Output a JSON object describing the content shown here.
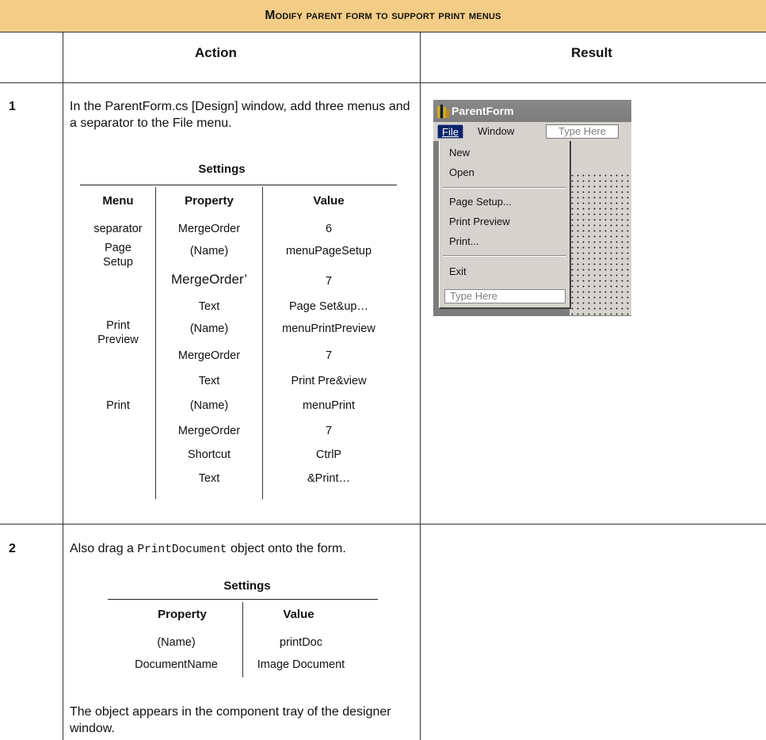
{
  "title": "Modify parent form to support print menus",
  "headers": {
    "action": "Action",
    "result": "Result"
  },
  "step1": {
    "number": "1",
    "text": "In the ParentForm.cs [Design] window, add three menus and a separator to the File menu.",
    "settings_title": "Settings",
    "columns": [
      "Menu",
      "Property",
      "Value"
    ],
    "rows": [
      {
        "menu": "separator",
        "property": "MergeOrder",
        "value": "6"
      },
      {
        "menu": "Page Setup",
        "property": "(Name)",
        "value": "menuPageSetup"
      },
      {
        "menu": "",
        "property": "MergeOrder’",
        "value": "7"
      },
      {
        "menu": "",
        "property": "Text",
        "value": "Page Set&up…"
      },
      {
        "menu": "Print Preview",
        "property": "(Name)",
        "value": "menuPrintPreview"
      },
      {
        "menu": "",
        "property": "MergeOrder",
        "value": "7"
      },
      {
        "menu": "",
        "property": "Text",
        "value": "Print Pre&view"
      },
      {
        "menu": "Print",
        "property": "(Name)",
        "value": "menuPrint"
      },
      {
        "menu": "",
        "property": "MergeOrder",
        "value": "7"
      },
      {
        "menu": "",
        "property": "Shortcut",
        "value": "CtrlP"
      },
      {
        "menu": "",
        "property": "Text",
        "value": "&Print…"
      }
    ]
  },
  "step2": {
    "number": "2",
    "text_before": "Also drag a ",
    "code": "PrintDocument",
    "text_after": " object onto the form.",
    "settings_title": "Settings",
    "columns": [
      "Property",
      "Value"
    ],
    "rows": [
      {
        "property": "(Name)",
        "value": "printDoc"
      },
      {
        "property": "DocumentName",
        "value": "Image Document"
      }
    ],
    "note": "The object appears in the component tray of the designer window."
  },
  "screenshot": {
    "window_title": "ParentForm",
    "menubar": [
      "File",
      "Window",
      "Type Here"
    ],
    "file_menu_items": [
      "New",
      "Open",
      "Page Setup...",
      "Print Preview",
      "Print...",
      "Exit"
    ],
    "type_here": "Type Here"
  }
}
